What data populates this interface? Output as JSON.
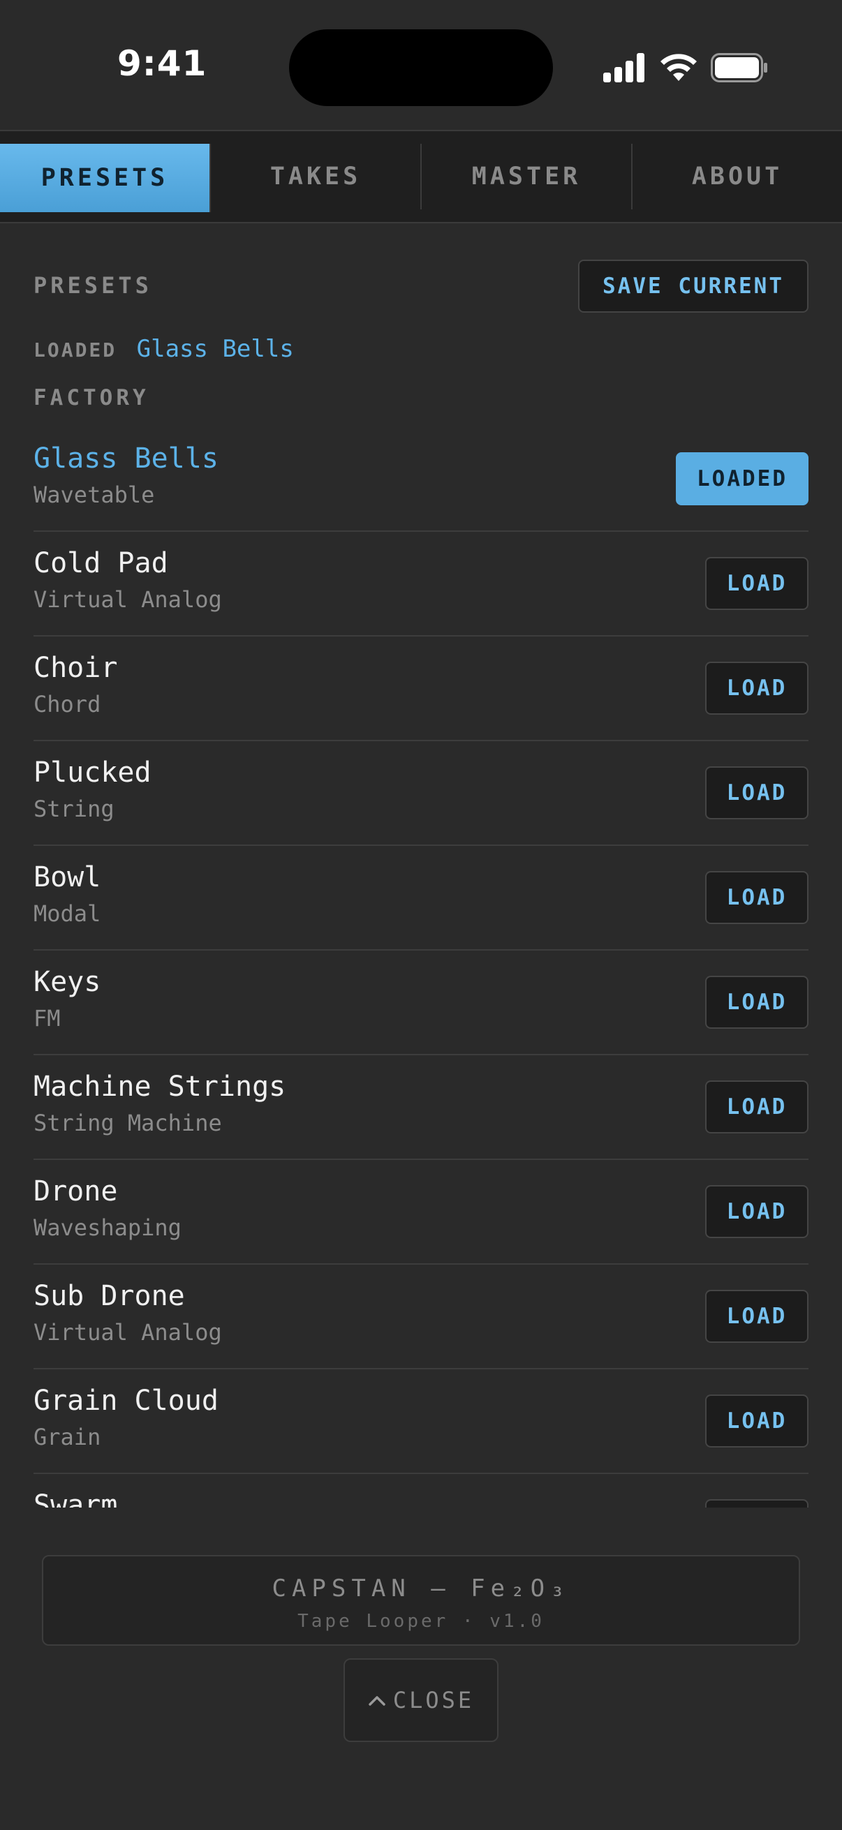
{
  "status_bar": {
    "time": "9:41"
  },
  "tabs": [
    {
      "label": "PRESETS",
      "active": true
    },
    {
      "label": "TAKES",
      "active": false
    },
    {
      "label": "MASTER",
      "active": false
    },
    {
      "label": "ABOUT",
      "active": false
    }
  ],
  "presets_panel": {
    "title": "PRESETS",
    "save_label": "SAVE CURRENT",
    "loaded_label": "LOADED",
    "loaded_value": "Glass Bells",
    "factory_label": "FACTORY",
    "items": [
      {
        "name": "Glass Bells",
        "engine": "Wavetable",
        "button": "LOADED",
        "loaded": true
      },
      {
        "name": "Cold Pad",
        "engine": "Virtual Analog",
        "button": "LOAD",
        "loaded": false
      },
      {
        "name": "Choir",
        "engine": "Chord",
        "button": "LOAD",
        "loaded": false
      },
      {
        "name": "Plucked",
        "engine": "String",
        "button": "LOAD",
        "loaded": false
      },
      {
        "name": "Bowl",
        "engine": "Modal",
        "button": "LOAD",
        "loaded": false
      },
      {
        "name": "Keys",
        "engine": "FM",
        "button": "LOAD",
        "loaded": false
      },
      {
        "name": "Machine Strings",
        "engine": "String Machine",
        "button": "LOAD",
        "loaded": false
      },
      {
        "name": "Drone",
        "engine": "Waveshaping",
        "button": "LOAD",
        "loaded": false
      },
      {
        "name": "Sub Drone",
        "engine": "Virtual Analog",
        "button": "LOAD",
        "loaded": false
      },
      {
        "name": "Grain Cloud",
        "engine": "Grain",
        "button": "LOAD",
        "loaded": false
      },
      {
        "name": "Swarm",
        "engine": "",
        "button": "",
        "loaded": false
      }
    ]
  },
  "footer": {
    "title": "CAPSTAN — Fe₂O₃",
    "subtitle": "Tape Looper · v1.0",
    "close_label": "CLOSE"
  },
  "colors": {
    "accent": "#5aaee3",
    "background": "#2a2a2a",
    "panel": "#1f1f1f"
  },
  "icons": [
    "signal-icon",
    "wifi-icon",
    "battery-icon",
    "chevron-up-icon"
  ]
}
